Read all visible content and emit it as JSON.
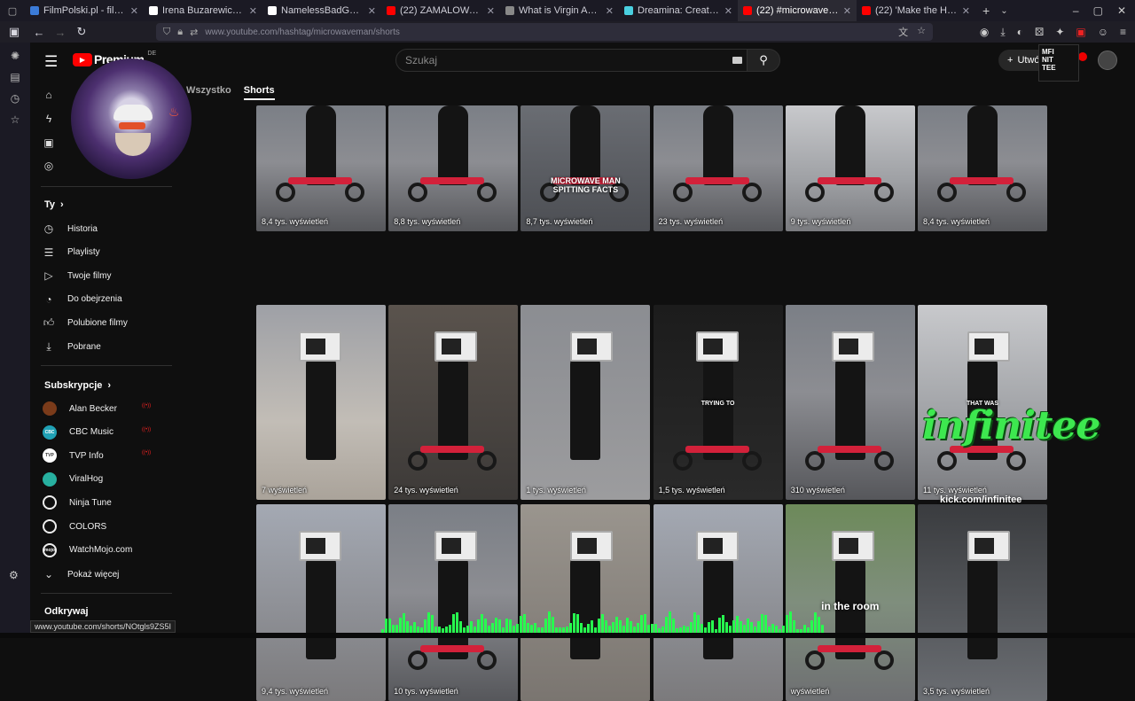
{
  "browser": {
    "tabs": [
      {
        "title": "FilmPolski.pl - filmoteka",
        "color": "#3b7bd8",
        "active": false
      },
      {
        "title": "Irena Buzarewicz (@IrenaB…",
        "color": "#ffffff",
        "active": false
      },
      {
        "title": "NamelessBadGuy on X: \"CR…",
        "color": "#ffffff",
        "active": false
      },
      {
        "title": "(22) ZAMALOWANY MURAL…",
        "color": "#ff0000",
        "active": false
      },
      {
        "title": "What is Virgin Active",
        "color": "#888888",
        "active": false
      },
      {
        "title": "Dreamina: Create realistic t…",
        "color": "#4ad0e0",
        "active": false
      },
      {
        "title": "(22) #microwaveman - You…",
        "color": "#ff0000",
        "active": true
      },
      {
        "title": "(22) 'Make the Hood Smile'…",
        "color": "#ff0000",
        "active": false
      }
    ],
    "url": "www.youtube.com/hashtag/microwaveman/shorts",
    "status_url": "www.youtube.com/shorts/NOtgls9ZS5I"
  },
  "header": {
    "logo_text": "Premium",
    "country": "DE",
    "search_placeholder": "Szukaj",
    "create_label": "Utwó"
  },
  "filters": {
    "all": "Wszystko",
    "shorts": "Shorts"
  },
  "sidebar": {
    "you_heading": "Ty",
    "you_items": [
      {
        "label": "Historia",
        "icon": "history-icon"
      },
      {
        "label": "Playlisty",
        "icon": "playlist-icon"
      },
      {
        "label": "Twoje filmy",
        "icon": "your-videos-icon"
      },
      {
        "label": "Do obejrzenia",
        "icon": "watch-later-icon"
      },
      {
        "label": "Polubione filmy",
        "icon": "like-icon"
      },
      {
        "label": "Pobrane",
        "icon": "download-icon"
      }
    ],
    "subs_heading": "Subskrypcje",
    "subs": [
      {
        "label": "Alan Becker",
        "bg": "#7a3b1a",
        "abbr": ""
      },
      {
        "label": "CBC Music",
        "bg": "#20a1b5",
        "abbr": "CBC"
      },
      {
        "label": "TVP Info",
        "bg": "#ffffff",
        "abbr": "TVP"
      },
      {
        "label": "ViralHog",
        "bg": "#27b0a0",
        "abbr": ""
      },
      {
        "label": "Ninja Tune",
        "bg": "#0f0f0f",
        "abbr": ""
      },
      {
        "label": "COLORS",
        "bg": "#0f0f0f",
        "abbr": ""
      },
      {
        "label": "WatchMojo.com",
        "bg": "#0f0f0f",
        "abbr": "mojo"
      }
    ],
    "show_more": "Pokaż więcej",
    "explore_heading": "Odkrywaj"
  },
  "shorts": [
    {
      "views": "8,4 tys. wyświetleń",
      "scene": "street",
      "overlay": ""
    },
    {
      "views": "8,8 tys. wyświetleń",
      "scene": "street",
      "overlay": ""
    },
    {
      "views": "8,7 tys. wyświetleń",
      "scene": "crosswalk",
      "overlay": "MICROWAVE MAN SPITTING FACTS"
    },
    {
      "views": "23 tys. wyświetleń",
      "scene": "street",
      "overlay": ""
    },
    {
      "views": "9 tys. wyświetleń",
      "scene": "light",
      "overlay": ""
    },
    {
      "views": "8,4 tys. wyświetleń",
      "scene": "street",
      "overlay": ""
    },
    {
      "views": "7 wyświetleń",
      "scene": "snow",
      "overlay": ""
    },
    {
      "views": "24 tys. wyświetleń",
      "scene": "garage",
      "overlay": ""
    },
    {
      "views": "1 tys. wyświetleń",
      "scene": "sidewalk",
      "overlay": ""
    },
    {
      "views": "1,5 tys. wyświetleń",
      "scene": "dark",
      "overlay": "TRYING TO"
    },
    {
      "views": "310 wyświetleń",
      "scene": "street",
      "overlay": ""
    },
    {
      "views": "11 tys. wyświetleń",
      "scene": "light",
      "overlay": "THAT WAS"
    },
    {
      "views": "9,4 tys. wyświetleń",
      "scene": "city",
      "overlay": ""
    },
    {
      "views": "10 tys. wyświetleń",
      "scene": "street",
      "overlay": ""
    },
    {
      "views": "",
      "scene": "wall",
      "overlay": ""
    },
    {
      "views": "",
      "scene": "city",
      "overlay": ""
    },
    {
      "views": "wyświetleń",
      "scene": "trees",
      "overlay": "in the room"
    },
    {
      "views": "3,5 tys. wyświetleń",
      "scene": "lowrider",
      "overlay": ""
    }
  ],
  "stream_overlay": {
    "brand": "infinitee",
    "sub": "kick.com/infinitee",
    "badge_lines": [
      "MFI",
      "NIT",
      "TEE"
    ]
  }
}
